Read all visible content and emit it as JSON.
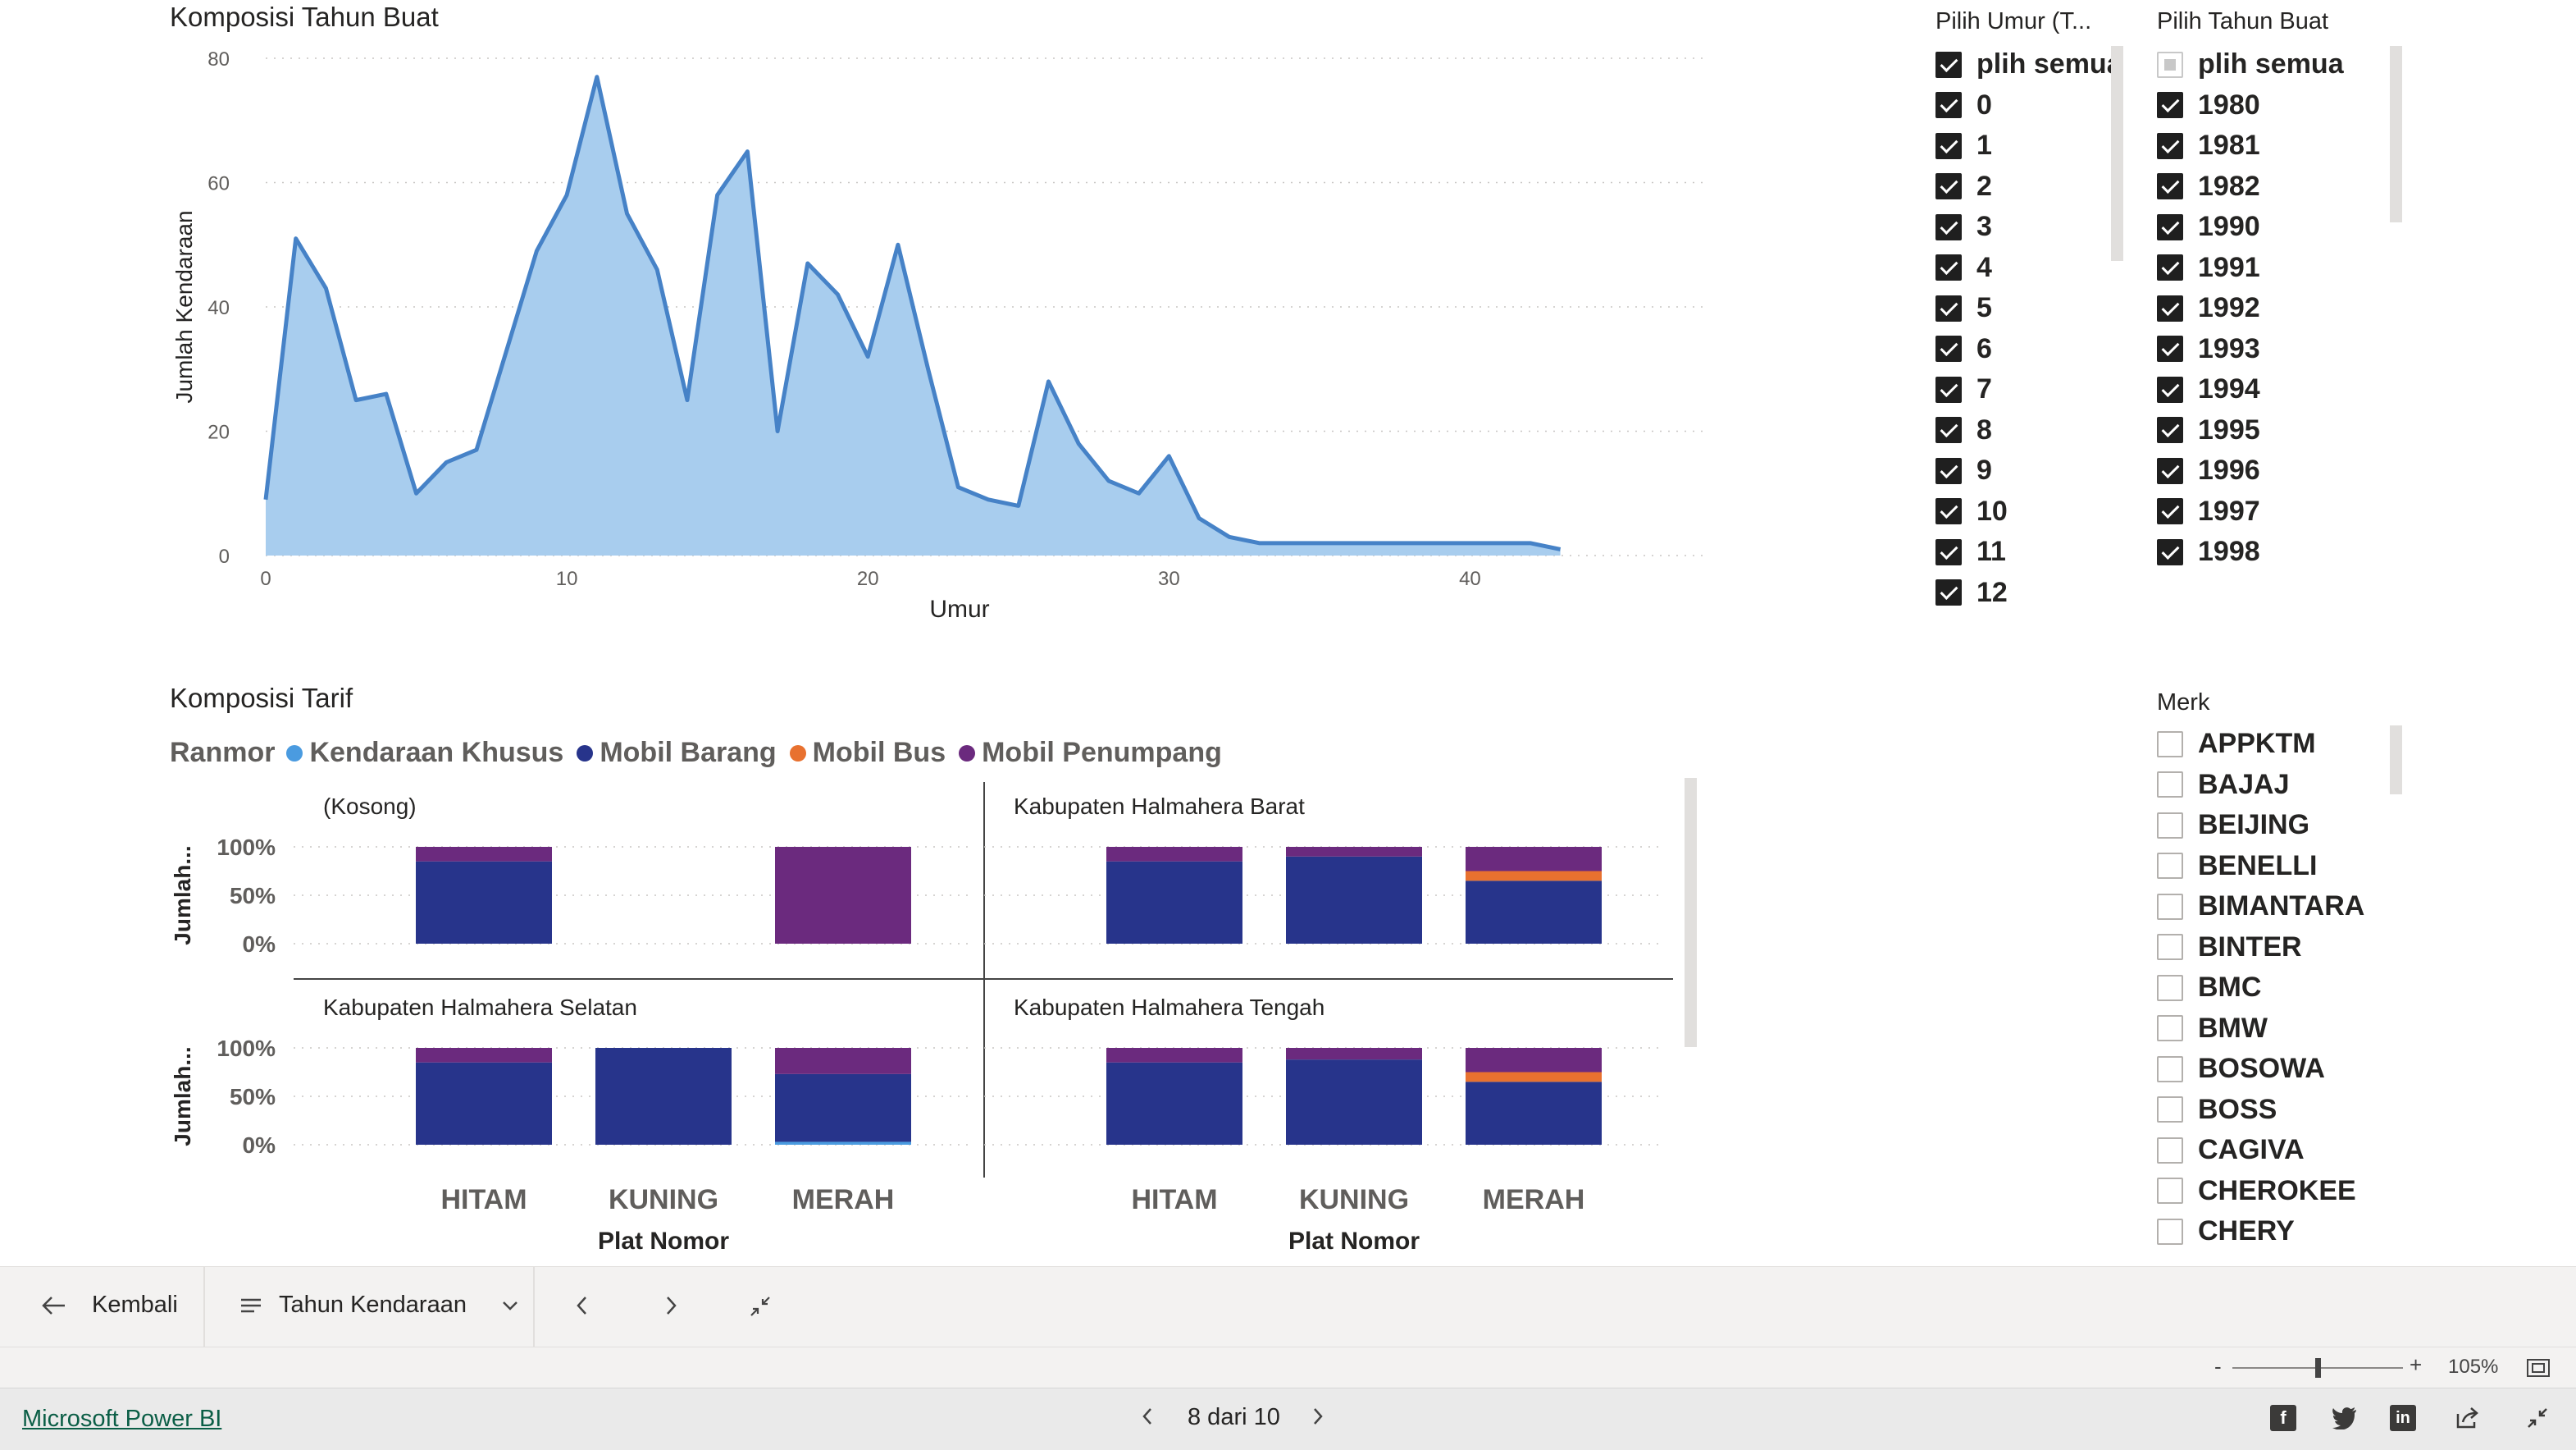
{
  "area_chart": {
    "title": "Komposisi Tahun Buat",
    "chart_data": {
      "type": "area",
      "title": "Komposisi Tahun Buat",
      "xlabel": "Umur",
      "ylabel": "Jumlah Kendaraan",
      "xlim": [
        0,
        45
      ],
      "ylim": [
        0,
        80
      ],
      "x_ticks": [
        "0",
        "10",
        "20",
        "30",
        "40"
      ],
      "y_ticks": [
        "0",
        "20",
        "40",
        "60",
        "80"
      ],
      "grid": true,
      "x": [
        0,
        1,
        2,
        3,
        4,
        5,
        6,
        7,
        8,
        9,
        10,
        11,
        12,
        13,
        14,
        15,
        16,
        17,
        18,
        19,
        20,
        21,
        22,
        23,
        24,
        25,
        26,
        27,
        28,
        29,
        30,
        31,
        32,
        33,
        34,
        35,
        36,
        37,
        38,
        39,
        40,
        41,
        42,
        43
      ],
      "values": [
        9,
        51,
        43,
        25,
        26,
        10,
        15,
        17,
        33,
        49,
        58,
        77,
        55,
        46,
        25,
        58,
        65,
        20,
        47,
        42,
        32,
        50,
        30,
        11,
        9,
        8,
        28,
        18,
        12,
        10,
        16,
        6,
        3,
        2,
        2,
        2,
        2,
        2,
        2,
        2,
        2,
        2,
        2,
        1
      ],
      "color": "#4682c7",
      "fill": "#a8cdee"
    }
  },
  "tariff_chart": {
    "title": "Komposisi Tarif",
    "legend_title": "Ranmor",
    "chart_data": {
      "type": "bar",
      "stacked": "100%",
      "title": "Komposisi Tarif",
      "xlabel": "Plat Nomor",
      "ylabel": "Jumlah...",
      "y_ticks": [
        "100%",
        "50%",
        "0%"
      ],
      "categories": [
        "HITAM",
        "KUNING",
        "MERAH"
      ],
      "legend": [
        {
          "name": "Kendaraan Khusus",
          "color": "#4a9be0"
        },
        {
          "name": "Mobil Barang",
          "color": "#27348b"
        },
        {
          "name": "Mobil Bus",
          "color": "#e8712f"
        },
        {
          "name": "Mobil Penumpang",
          "color": "#6b2a7e"
        }
      ],
      "panels": [
        {
          "title": "(Kosong)",
          "bars": [
            {
              "category": "HITAM",
              "stack": [
                0,
                0.85,
                0,
                0.15
              ]
            },
            null,
            {
              "category": "MERAH",
              "stack": [
                0,
                0,
                0,
                1.0
              ]
            }
          ]
        },
        {
          "title": "Kabupaten Halmahera Barat",
          "bars": [
            {
              "category": "HITAM",
              "stack": [
                0,
                0.85,
                0,
                0.15
              ]
            },
            {
              "category": "KUNING",
              "stack": [
                0,
                0.9,
                0,
                0.1
              ]
            },
            {
              "category": "MERAH",
              "stack": [
                0,
                0.65,
                0.1,
                0.25
              ]
            }
          ]
        },
        {
          "title": "Kabupaten Halmahera Selatan",
          "bars": [
            {
              "category": "HITAM",
              "stack": [
                0,
                0.85,
                0,
                0.15
              ]
            },
            {
              "category": "KUNING",
              "stack": [
                0,
                1.0,
                0,
                0
              ]
            },
            {
              "category": "MERAH",
              "stack": [
                0.03,
                0.7,
                0,
                0.27
              ]
            }
          ]
        },
        {
          "title": "Kabupaten Halmahera Tengah",
          "bars": [
            {
              "category": "HITAM",
              "stack": [
                0,
                0.85,
                0,
                0.15
              ]
            },
            {
              "category": "KUNING",
              "stack": [
                0,
                0.88,
                0,
                0.12
              ]
            },
            {
              "category": "MERAH",
              "stack": [
                0,
                0.65,
                0.1,
                0.25
              ]
            }
          ]
        }
      ]
    }
  },
  "slicer_umur": {
    "title": "Pilih Umur (T...",
    "items": [
      {
        "label": "plih semua",
        "state": "checked"
      },
      {
        "label": "0",
        "state": "checked"
      },
      {
        "label": "1",
        "state": "checked"
      },
      {
        "label": "2",
        "state": "checked"
      },
      {
        "label": "3",
        "state": "checked"
      },
      {
        "label": "4",
        "state": "checked"
      },
      {
        "label": "5",
        "state": "checked"
      },
      {
        "label": "6",
        "state": "checked"
      },
      {
        "label": "7",
        "state": "checked"
      },
      {
        "label": "8",
        "state": "checked"
      },
      {
        "label": "9",
        "state": "checked"
      },
      {
        "label": "10",
        "state": "checked"
      },
      {
        "label": "11",
        "state": "checked"
      },
      {
        "label": "12",
        "state": "checked"
      }
    ]
  },
  "slicer_tahun": {
    "title": "Pilih Tahun Buat",
    "items": [
      {
        "label": "plih semua",
        "state": "partial"
      },
      {
        "label": "1980",
        "state": "checked"
      },
      {
        "label": "1981",
        "state": "checked"
      },
      {
        "label": "1982",
        "state": "checked"
      },
      {
        "label": "1990",
        "state": "checked"
      },
      {
        "label": "1991",
        "state": "checked"
      },
      {
        "label": "1992",
        "state": "checked"
      },
      {
        "label": "1993",
        "state": "checked"
      },
      {
        "label": "1994",
        "state": "checked"
      },
      {
        "label": "1995",
        "state": "checked"
      },
      {
        "label": "1996",
        "state": "checked"
      },
      {
        "label": "1997",
        "state": "checked"
      },
      {
        "label": "1998",
        "state": "checked"
      }
    ]
  },
  "slicer_merk": {
    "title": "Merk",
    "items": [
      {
        "label": "APPKTM",
        "state": "empty"
      },
      {
        "label": "BAJAJ",
        "state": "empty"
      },
      {
        "label": "BEIJING",
        "state": "empty"
      },
      {
        "label": "BENELLI",
        "state": "empty"
      },
      {
        "label": "BIMANTARA",
        "state": "empty"
      },
      {
        "label": "BINTER",
        "state": "empty"
      },
      {
        "label": "BMC",
        "state": "empty"
      },
      {
        "label": "BMW",
        "state": "empty"
      },
      {
        "label": "BOSOWA",
        "state": "empty"
      },
      {
        "label": "BOSS",
        "state": "empty"
      },
      {
        "label": "CAGIVA",
        "state": "empty"
      },
      {
        "label": "CHEROKEE",
        "state": "empty"
      },
      {
        "label": "CHERY",
        "state": "empty"
      }
    ]
  },
  "nav": {
    "back_label": "Kembali",
    "page_select_label": "Tahun Kendaraan",
    "icons": {
      "back": "arrow-left-icon",
      "pages": "menu-lines-icon",
      "chevron": "chevron-down-icon",
      "prev": "chevron-left-icon",
      "next": "chevron-right-icon",
      "fit": "collapse-icon"
    }
  },
  "zoom": {
    "minus": "-",
    "plus": "+",
    "level": "105%",
    "level_fraction": 0.5
  },
  "footer": {
    "brand_link": "Microsoft Power BI",
    "page_indicator": "8 dari 10",
    "social": [
      "facebook-icon",
      "twitter-icon",
      "linkedin-icon",
      "share-icon",
      "fullscreen-icon"
    ]
  },
  "colors": {
    "accent_line": "#4682c7",
    "area_fill": "#a8cdee",
    "text": "#252423",
    "link": "#0b5e46"
  }
}
